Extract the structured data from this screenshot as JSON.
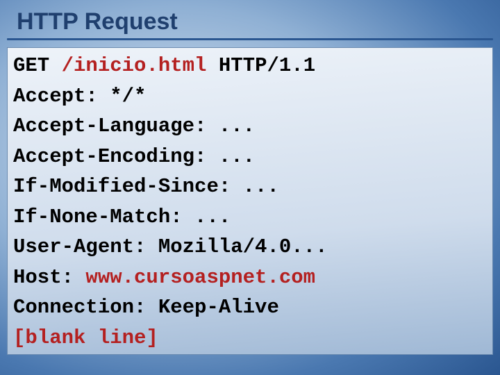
{
  "slide": {
    "title": "HTTP Request"
  },
  "http": {
    "method": "GET ",
    "path": "/inicio.html",
    "version": " HTTP/1.1",
    "headers": {
      "accept": "Accept: */*",
      "accept_language": "Accept-Language: ...",
      "accept_encoding": "Accept-Encoding: ...",
      "if_modified_since": "If-Modified-Since: ...",
      "if_none_match": "If-None-Match: ...",
      "user_agent": "User-Agent: Mozilla/4.0...",
      "host_label": "Host: ",
      "host_value": "www.cursoaspnet.com",
      "connection": "Connection: Keep-Alive"
    },
    "blank_line": "[blank line]"
  }
}
